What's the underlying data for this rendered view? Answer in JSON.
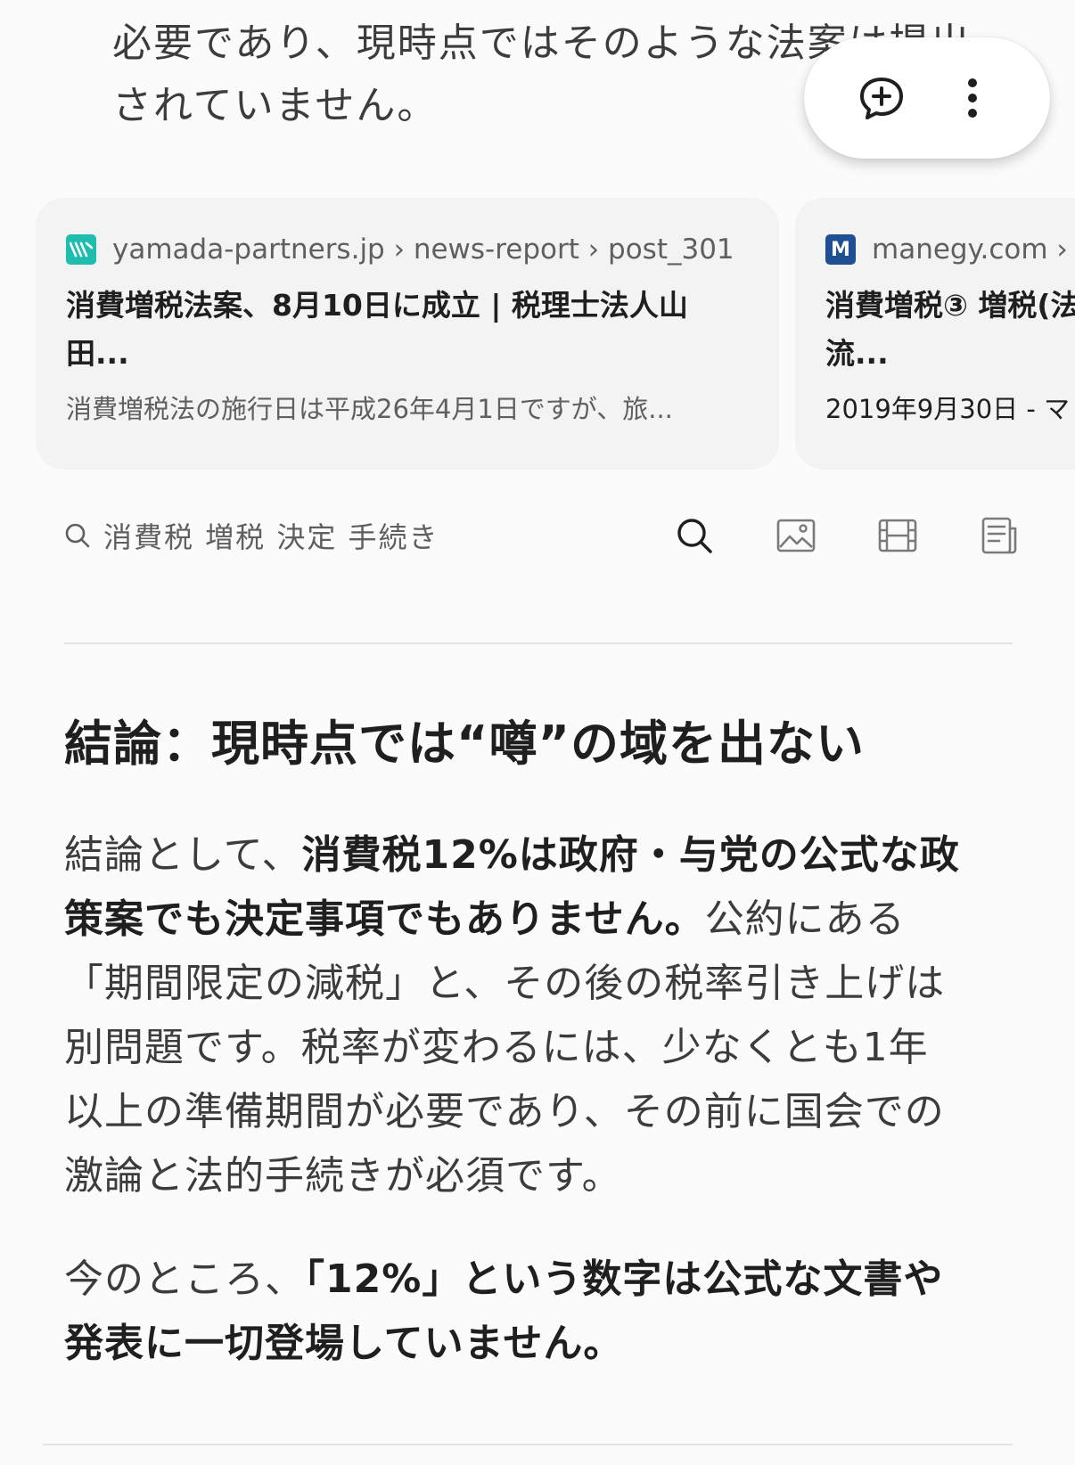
{
  "top_text": {
    "line1": "必要であり、現時点ではそのような法案は提出",
    "line2": "されていません。"
  },
  "floating_actions": {
    "add_comment_icon": "add-comment-icon",
    "more_icon": "more-vert-icon"
  },
  "source_cards": [
    {
      "favicon_letter": "W",
      "favicon_color": "#1fbdb0",
      "breadcrumb": "yamada-partners.jp › news-report › post_301",
      "title_line1": "消費増税法案、8月10日に成立 | 税理士法人山",
      "title_line2": "田...",
      "snippet": "消費増税法の施行日は平成26年4月1日ですが、旅..."
    },
    {
      "favicon_letter": "M",
      "favicon_color": "#1e4f93",
      "breadcrumb": "manegy.com ›",
      "title_line1": "消費増税③ 増税(法",
      "title_line2": "流...",
      "snippet": "2019年9月30日 - マ"
    }
  ],
  "search_suggestion": {
    "query": "消費税 増税 決定 手続き",
    "actions": [
      "search-icon",
      "image-icon",
      "video-icon",
      "news-icon"
    ]
  },
  "heading": "結論：現時点では“噂”の域を出ない",
  "paragraph1": {
    "l1_plain": "結論として、",
    "l1_bold": "消費税12%は政府・与党の公式な政",
    "l2_bold": "策案でも決定事項でもありません。",
    "l2_plain": "公約にある",
    "l3": "「期間限定の減税」と、その後の税率引き上げは",
    "l4": "別問題です。税率が変わるには、少なくとも1年",
    "l5": "以上の準備期間が必要であり、その前に国会での",
    "l6": "激論と法的手続きが必須です。"
  },
  "paragraph2": {
    "l1_plain": "今のところ、",
    "l1_bold": "「12%」という数字は公式な文書や",
    "l2_bold": "発表に一切登場していません。"
  }
}
